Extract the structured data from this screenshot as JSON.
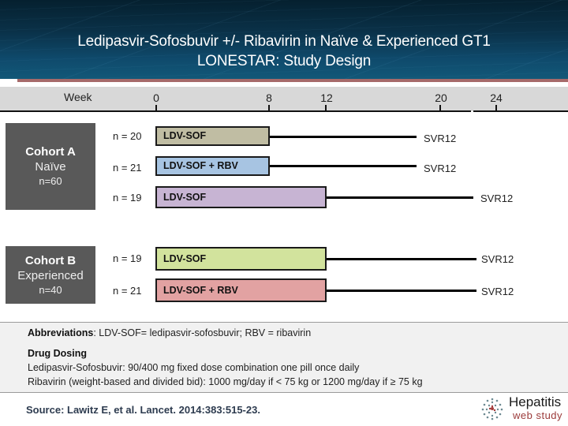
{
  "header": {
    "title_line1": "Ledipasvir-Sofosbuvir +/- Ribavirin in Naïve & Experienced GT1",
    "title_line2": "LONESTAR: Study Design"
  },
  "timeline": {
    "label": "Week",
    "ticks": [
      "0",
      "8",
      "12",
      "20",
      "24"
    ]
  },
  "cohorts": [
    {
      "name": "Cohort A",
      "subtitle": "Naïve",
      "n": "n=60"
    },
    {
      "name": "Cohort B",
      "subtitle": "Experienced",
      "n": "n=40"
    }
  ],
  "arms": [
    {
      "n": "n = 20",
      "regimen": "LDV-SOF",
      "treatment_weeks": 8,
      "endpoint": "SVR12",
      "color": "#c0bda3"
    },
    {
      "n": "n = 21",
      "regimen": "LDV-SOF + RBV",
      "treatment_weeks": 8,
      "endpoint": "SVR12",
      "color": "#a7c4e2"
    },
    {
      "n": "n = 19",
      "regimen": "LDV-SOF",
      "treatment_weeks": 12,
      "endpoint": "SVR12",
      "color": "#c7b4d3"
    },
    {
      "n": "n = 19",
      "regimen": "LDV-SOF",
      "treatment_weeks": 12,
      "endpoint": "SVR12",
      "color": "#d2e39d"
    },
    {
      "n": "n = 21",
      "regimen": "LDV-SOF + RBV",
      "treatment_weeks": 12,
      "endpoint": "SVR12",
      "color": "#e2a2a2"
    }
  ],
  "notes": {
    "abbrev_label": "Abbreviations",
    "abbrev_text": ": LDV-SOF= ledipasvir-sofosbuvir; RBV = ribavirin",
    "dosing_label": "Drug Dosing",
    "dosing_line1": "Ledipasvir-Sofosbuvir: 90/400 mg fixed dose combination one pill once daily",
    "dosing_line2": "Ribavirin (weight-based and divided bid): 1000 mg/day if < 75 kg or 1200 mg/day if ≥ 75 kg"
  },
  "source": "Source: Lawitz E, et al. Lancet. 2014:383:515-23.",
  "logo": {
    "brand_line1": "Hepatitis",
    "brand_line2": "web study",
    "icon": "dotted-globe-icon"
  }
}
